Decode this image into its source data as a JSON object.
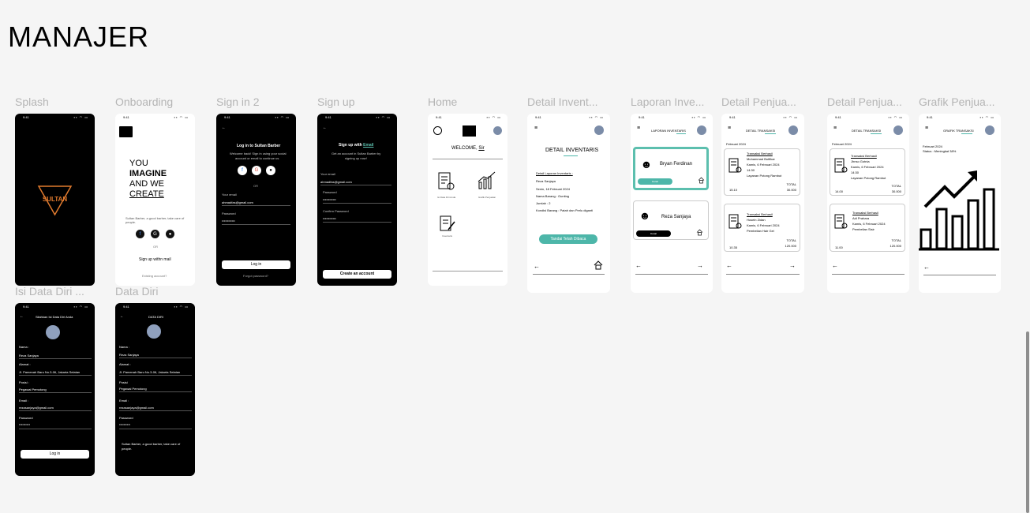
{
  "page_title": "MANAJER",
  "frame_labels": [
    "Splash",
    "Onboarding",
    "Sign in 2",
    "Sign up",
    "Home",
    "Detail Invent...",
    "Laporan Inve...",
    "Detail Penjua...",
    "Detail Penjua...",
    "Grafik Penjua...",
    "Isi Data Diri ...",
    "Data Diri"
  ],
  "status": {
    "time": "9:41",
    "icons": "▪▪ ◠ ▭"
  },
  "splash": {
    "logo": "SULTAN"
  },
  "onboarding": {
    "l1": "YOU",
    "l2": "IMAGINE",
    "l3": "AND WE",
    "l4": "CREATE",
    "desc": "Sultan Barber, a good barber, take care of people.",
    "or": "OR",
    "signup": "Sign up withn mail",
    "existing": "Existing account?"
  },
  "signin": {
    "title_pre": "Log in to ",
    "title_brand": "Sultan Barber",
    "sub1": "Welcome back! Sign in using your social",
    "sub2": "account or email to continue us",
    "or": "OR",
    "email_label": "Your email",
    "email_value": "ahmadfas@gmail.com",
    "pass_label": "Password",
    "pass_value": "••••••••••••",
    "login": "Log in",
    "forgot": "Forgot password?"
  },
  "signup": {
    "title_pre": "Sign up with ",
    "title_link": "Email",
    "sub1": "Get an account in Sultan Barber by",
    "sub2": "signing up now!",
    "email_label": "Your email",
    "email_value": "ahmadfas@gmail.com",
    "pass_label": "Password",
    "pass_value": "••••••••••••",
    "confirm_label": "Confirm Password",
    "confirm_value": "••••••••••••",
    "create": "Create an account"
  },
  "home": {
    "welcome": "WELCOME, ",
    "sir": "Sir",
    "m1": "Isi Data Diri Anda",
    "m2": "Grafik Penjualan",
    "m3": "Inventaris"
  },
  "detail_inv": {
    "title": "DETAIL INVENTARIS",
    "lap": "Detail Laporan Inventaris :",
    "name": "Reza Sanjaya",
    "date": "Senin, 18 Februari 2024",
    "barang": "Nama Barang : Gunting",
    "jumlah": "Jumlah : 2",
    "kondisi": "Kondisi Barang : Patah dan Perlu diganti",
    "btn": "Tandai Telah Dibaca"
  },
  "laporan": {
    "header": "LAPORAN INVENTARIS",
    "n1": "Bryan Ferdinan",
    "n2": "Reza Sanjaya",
    "detail": "Detail"
  },
  "penj1": {
    "header": "DETAIL TRANSAKSI",
    "month": "Februari 2024",
    "c1": {
      "t": "Transaksi Berhasil",
      "n": "Muhammad Butfikar",
      "d": "Kamis, 6 Februari 2024",
      "h": "14:30",
      "s": "Layanan Potong Rambut",
      "total": "TOTAL",
      "time": "15.10",
      "amt": "30.000"
    },
    "c2": {
      "t": "Transaksi Berhasil",
      "n": "Husein Zidan",
      "d": "Kamis, 6 Februari 2024",
      "s": "Pembelian Hair Gel",
      "total": "TOTAL",
      "time": "10.35",
      "amt": "120.000"
    }
  },
  "penj2": {
    "header": "DETAIL TRANSAKSI",
    "month": "Februari 2024",
    "c1": {
      "t": "Transaksi Berhasil",
      "n": "Jhnso Gotnia",
      "d": "Kamis, 6 Februari 2024",
      "h": "14:30",
      "s": "Layanan Potong Rambut",
      "total": "TOTAL",
      "time": "14.00",
      "amt": "30.000"
    },
    "c2": {
      "t": "Transaksi Berhasil",
      "n": "Adi Prahara",
      "d": "Kamis, 6 Februari 2024",
      "s": "Pembelian Sisir",
      "total": "TOTAL",
      "time": "11.00",
      "amt": "120.000"
    }
  },
  "grafik": {
    "header": "GRAFIK TRANSAKSI",
    "month": "Februari 2024",
    "status": "Status : Meningkat 38%"
  },
  "isidata": {
    "title": "Silahkan Isi Data Diri Anda",
    "nama_l": "Nama :",
    "nama_v": "Reza Sanjaya",
    "alamat_l": "Alamat :",
    "alamat_v": "Jl. Pamenah Baru No.3-06, Jakarta Selatan",
    "posisi_l": "Posisi :",
    "posisi_v": "Pegawai Pemotong",
    "email_l": "Email :",
    "email_v": "rezasanjaya@gmail.com",
    "pass_l": "Password",
    "pass_v": "••••••••••",
    "btn": "Log in"
  },
  "datadiri": {
    "title": "DATA DIRI",
    "nama_l": "Nama :",
    "nama_v": "Reza Sanjaya",
    "alamat_l": "Alamat :",
    "alamat_v": "Jl. Pamenah Baru No.3-06, Jakarta Selatan",
    "posisi_l": "Posisi",
    "posisi_v": "Pegawai Pemotong",
    "email_l": "Email :",
    "email_v": "rezasanjaya@gmail.com",
    "pass_l": "Password",
    "pass_v": "••••••••••",
    "footer1": "Sultan Barber, a good barber, take care of",
    "footer2": "people."
  },
  "colors": {
    "accent": "#4db6a9",
    "accent_border": "#5cbfae",
    "logo": "#e07a2e"
  }
}
